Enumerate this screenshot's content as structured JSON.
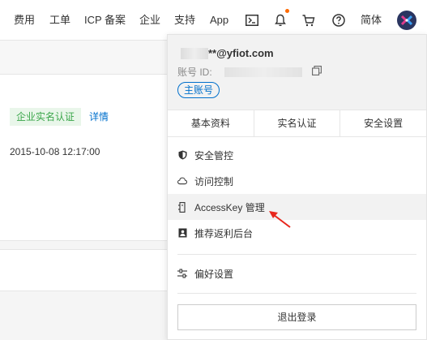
{
  "nav": {
    "fee": "费用",
    "ticket": "工单",
    "icp": "ICP 备案",
    "enterprise": "企业",
    "support": "支持",
    "app": "App",
    "lang": "简体"
  },
  "background": {
    "verify_badge": "企业实名认证",
    "detail_link": "详情",
    "date": "2015-10-08 12:17:00"
  },
  "account": {
    "email_suffix": "**@yfiot.com",
    "uid_label": "账号 ID:",
    "main_account_tag": "主账号"
  },
  "tabs": [
    "基本资料",
    "实名认证",
    "安全设置"
  ],
  "menu": {
    "security_control": "安全管控",
    "access_control": "访问控制",
    "accesskey": "AccessKey 管理",
    "referral": "推荐返利后台",
    "preferences": "偏好设置"
  },
  "logout": "退出登录",
  "colors": {
    "accent_blue": "#0070cc",
    "badge_green": "#3aa64a",
    "annotation_red": "#e8261c",
    "notification_orange": "#ff6a00"
  }
}
